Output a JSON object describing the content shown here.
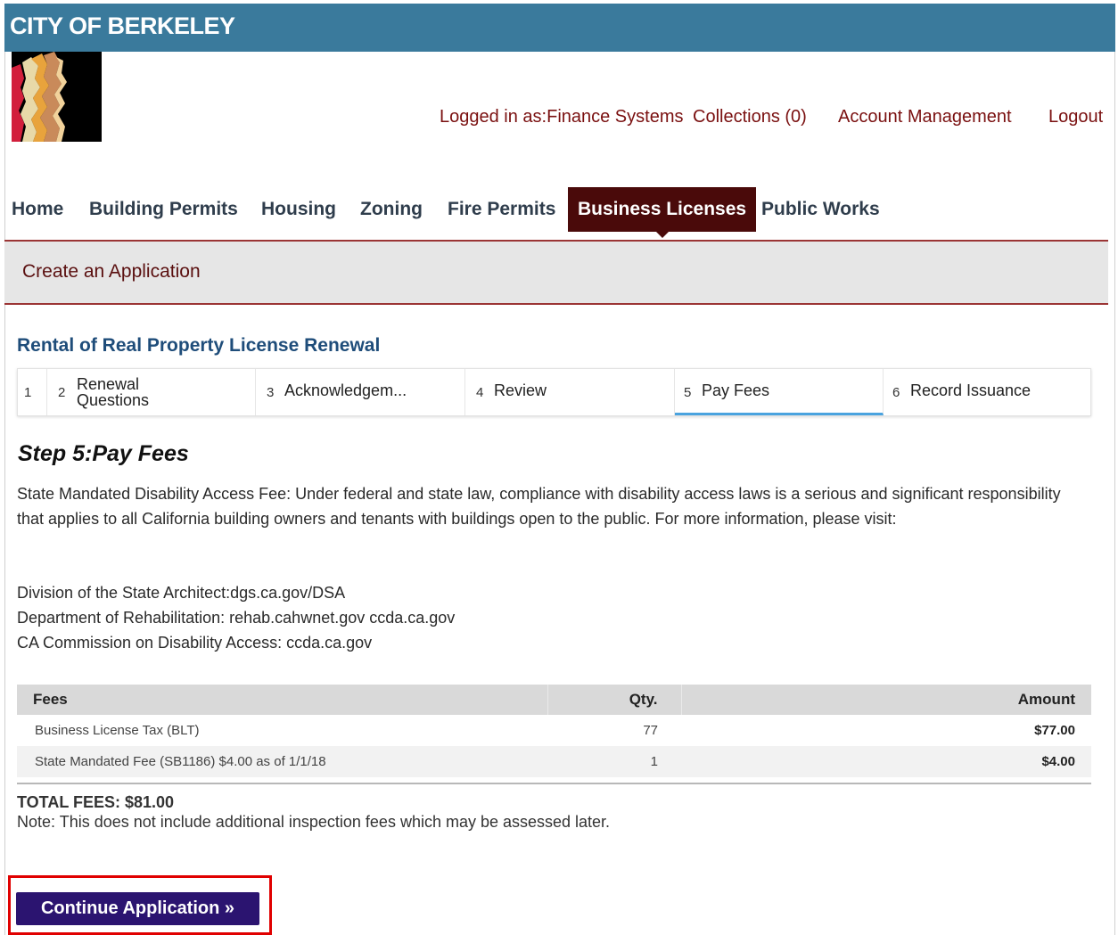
{
  "header": {
    "city_name": "CITY OF BERKELEY"
  },
  "logo": {
    "colors": [
      "#000000",
      "#d21f3c",
      "#e8a33c",
      "#c98a5a",
      "#f2d29b"
    ]
  },
  "user_links": {
    "logged_in": "Logged in as:Finance Systems",
    "collections": "Collections (0)",
    "account": "Account Management",
    "logout": "Logout"
  },
  "nav": {
    "items": [
      {
        "label": "Home"
      },
      {
        "label": "Building Permits"
      },
      {
        "label": "Housing"
      },
      {
        "label": "Zoning"
      },
      {
        "label": "Fire Permits"
      },
      {
        "label": "Business Licenses",
        "active": true
      },
      {
        "label": "Public Works"
      }
    ]
  },
  "sub_header": {
    "title": "Create an Application"
  },
  "application": {
    "title": "Rental of Real Property License Renewal"
  },
  "steps": [
    {
      "num": "1",
      "label": ""
    },
    {
      "num": "2",
      "label_line1": "Renewal",
      "label_line2": "Questions"
    },
    {
      "num": "3",
      "label": "Acknowledgem..."
    },
    {
      "num": "4",
      "label": "Review"
    },
    {
      "num": "5",
      "label": "Pay Fees",
      "active": true
    },
    {
      "num": "6",
      "label": "Record Issuance"
    }
  ],
  "content": {
    "heading": "Step 5:Pay Fees",
    "paragraph": "State Mandated Disability Access Fee: Under federal and state law, compliance with disability access laws is a serious and significant responsibility that applies to all California building owners and tenants with buildings open to the public. For more information, please visit:",
    "links": [
      "Division of the State Architect:dgs.ca.gov/DSA",
      "Department of Rehabilitation: rehab.cahwnet.gov ccda.ca.gov",
      "CA Commission on Disability Access: ccda.ca.gov"
    ]
  },
  "fees_table": {
    "headers": {
      "fees": "Fees",
      "qty": "Qty.",
      "amount": "Amount"
    },
    "rows": [
      {
        "fee": "Business License Tax (BLT)",
        "qty": "77",
        "amount": "$77.00"
      },
      {
        "fee": "State Mandated Fee (SB1186) $4.00 as of 1/1/18",
        "qty": "1",
        "amount": "$4.00"
      }
    ]
  },
  "totals": {
    "total": "TOTAL FEES: $81.00",
    "note": "Note: This does not include additional inspection fees which may be assessed later."
  },
  "actions": {
    "continue_label": "Continue Application »"
  },
  "colors": {
    "top_bar": "#3a7a9c",
    "active_nav": "#4a0a0a",
    "link_red": "#7a1010",
    "app_title": "#1f4d7a",
    "continue_button": "#2b1470",
    "highlight": "#e00000",
    "step_active": "#4aa3df"
  }
}
